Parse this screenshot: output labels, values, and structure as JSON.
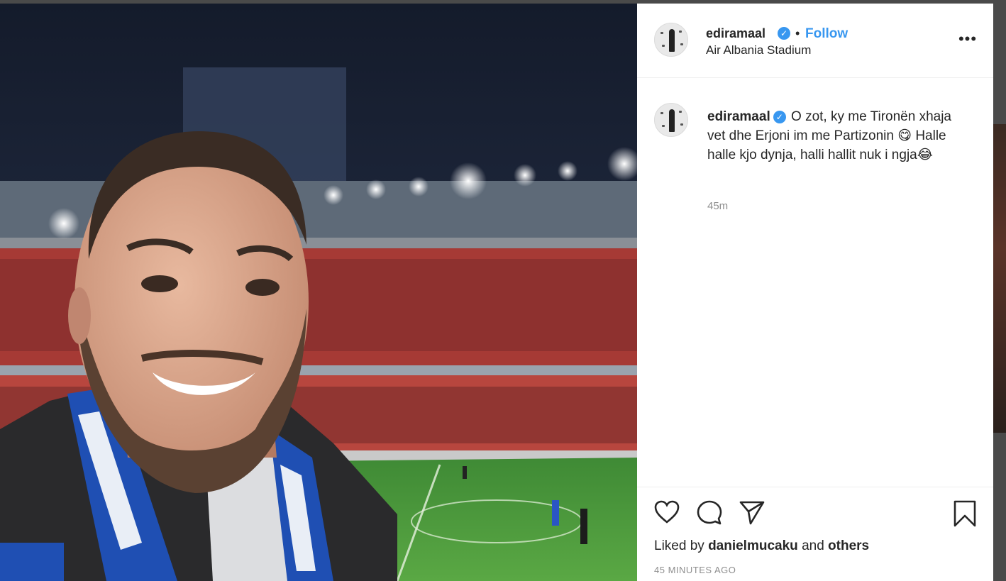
{
  "post": {
    "username": "ediramaal",
    "verified_mark": "✓",
    "separator": "•",
    "follow_label": "Follow",
    "location": "Air Albania Stadium",
    "more_label": "•••",
    "caption": {
      "username": "ediramaal",
      "text": "O zot, ky me Tironën xhaja vet dhe Erjoni im me Partizonin 😋 Halle halle kjo dynja, halli hallit nuk i ngja😂",
      "time": "45m"
    },
    "likes": {
      "prefix": "Liked by",
      "user": "danielmucaku",
      "conjunction": "and",
      "others": "others"
    },
    "posted_ago": "45 MINUTES AGO"
  },
  "photo": {
    "subject": "stadium selfie",
    "colors": {
      "sky": "#1b2436",
      "seats": "#b8463e",
      "pitch": "#4e9a3c",
      "scarf_blue": "#1f4fb3",
      "scarf_white": "#e9eef6"
    }
  },
  "icons": {
    "like": "heart-icon",
    "comment": "comment-bubble-icon",
    "share": "paper-plane-icon",
    "save": "bookmark-icon",
    "more": "more-dots-icon"
  },
  "colors": {
    "accent": "#3897f0",
    "text": "#262626",
    "muted": "#8e8e8e"
  }
}
